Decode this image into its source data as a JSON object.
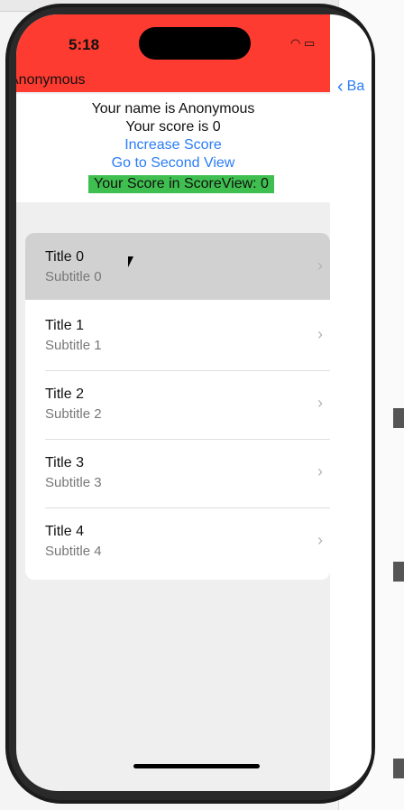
{
  "status_bar": {
    "time": "5:18",
    "status_icons": "􀙇 ▮"
  },
  "header": {
    "title": "Anonymous"
  },
  "back_link": {
    "label": "Ba"
  },
  "info": {
    "name_line": "Your name is Anonymous",
    "score_line": "Your score is 0",
    "increase_score": "Increase Score",
    "go_second_view": "Go to Second View",
    "score_view_label": "Your Score in ScoreView: 0"
  },
  "list": {
    "rows": [
      {
        "title": "Title 0",
        "subtitle": "Subtitle 0"
      },
      {
        "title": "Title 1",
        "subtitle": "Subtitle 1"
      },
      {
        "title": "Title 2",
        "subtitle": "Subtitle 2"
      },
      {
        "title": "Title 3",
        "subtitle": "Subtitle 3"
      },
      {
        "title": "Title 4",
        "subtitle": "Subtitle 4"
      }
    ]
  },
  "colors": {
    "header_red": "#fe3b30",
    "link_blue": "#2a7cf7",
    "score_green": "#3fbf4f",
    "selected_row": "#d1d1d1"
  }
}
